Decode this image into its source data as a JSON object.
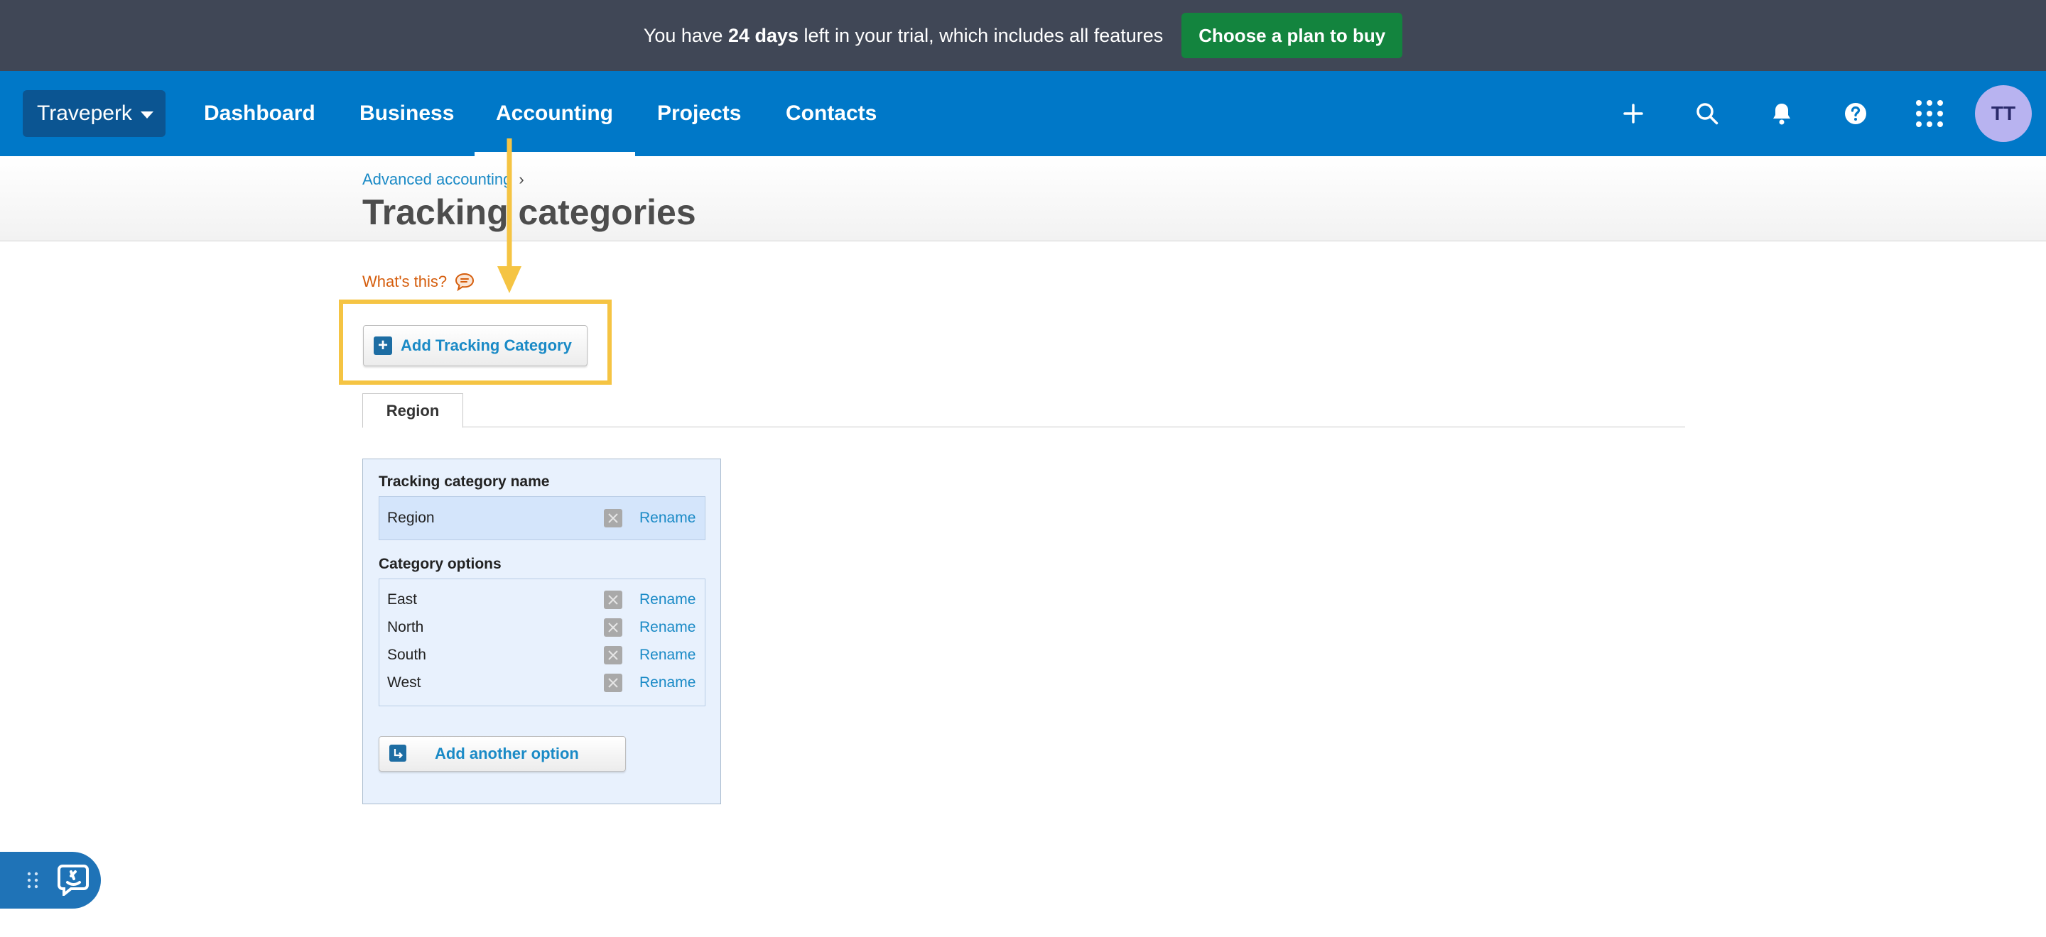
{
  "trial": {
    "prefix": "You have ",
    "days": "24 days",
    "suffix": " left in your trial, which includes all features",
    "cta": "Choose a plan to buy"
  },
  "nav": {
    "org": "Traveperk",
    "tabs": [
      "Dashboard",
      "Business",
      "Accounting",
      "Projects",
      "Contacts"
    ],
    "active_tab": "Accounting",
    "icons": [
      "plus-icon",
      "search-icon",
      "bell-icon",
      "help-icon",
      "apps-grid-icon"
    ],
    "avatar": "TT"
  },
  "header": {
    "breadcrumb": "Advanced accounting",
    "breadcrumb_sep": "›",
    "title": "Tracking categories"
  },
  "whats_this": "What's this?",
  "add_tracking_button": "Add Tracking Category",
  "tab": "Region",
  "panel": {
    "name_label": "Tracking category name",
    "name_value": "Region",
    "rename": "Rename",
    "options_label": "Category options",
    "options": [
      "East",
      "North",
      "South",
      "West"
    ],
    "add_option": "Add another option"
  },
  "colors": {
    "trial_bg": "#404756",
    "cta_green": "#13843e",
    "nav_blue": "#0078c8",
    "link_blue": "#1a8ac6",
    "highlight_yellow": "#f5c443",
    "panel_bg": "#e8f1fd"
  }
}
